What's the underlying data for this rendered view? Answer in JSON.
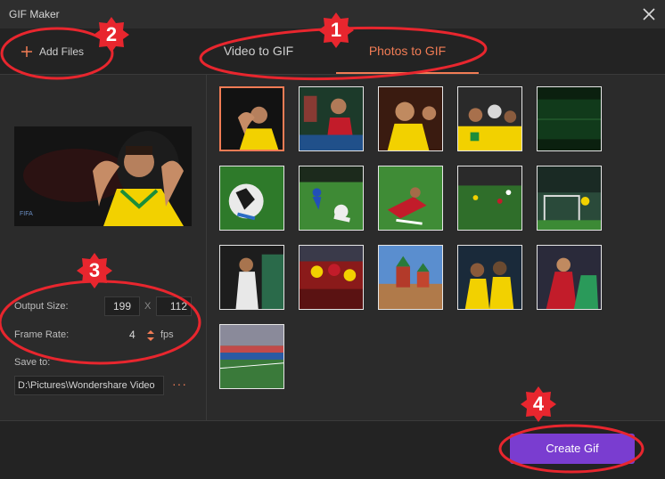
{
  "window": {
    "title": "GIF Maker"
  },
  "toolbar": {
    "add_files": "Add Files"
  },
  "tabs": [
    {
      "label": "Video to GIF"
    },
    {
      "label": "Photos to GIF"
    }
  ],
  "settings": {
    "output_size_label": "Output Size:",
    "width": "199",
    "separator": "X",
    "height": "112",
    "frame_rate_label": "Frame Rate:",
    "frame_rate": "4",
    "fps_unit": "fps",
    "save_to_label": "Save to:",
    "save_path": "D:\\Pictures\\Wondershare Video",
    "browse": "···"
  },
  "footer": {
    "create_gif": "Create Gif"
  },
  "callouts": [
    {
      "label": "1"
    },
    {
      "label": "2"
    },
    {
      "label": "3"
    },
    {
      "label": "4"
    }
  ],
  "colors": {
    "accent": "#f17c55",
    "primary_button": "#7a3dd0",
    "annotation": "#e8262e"
  }
}
